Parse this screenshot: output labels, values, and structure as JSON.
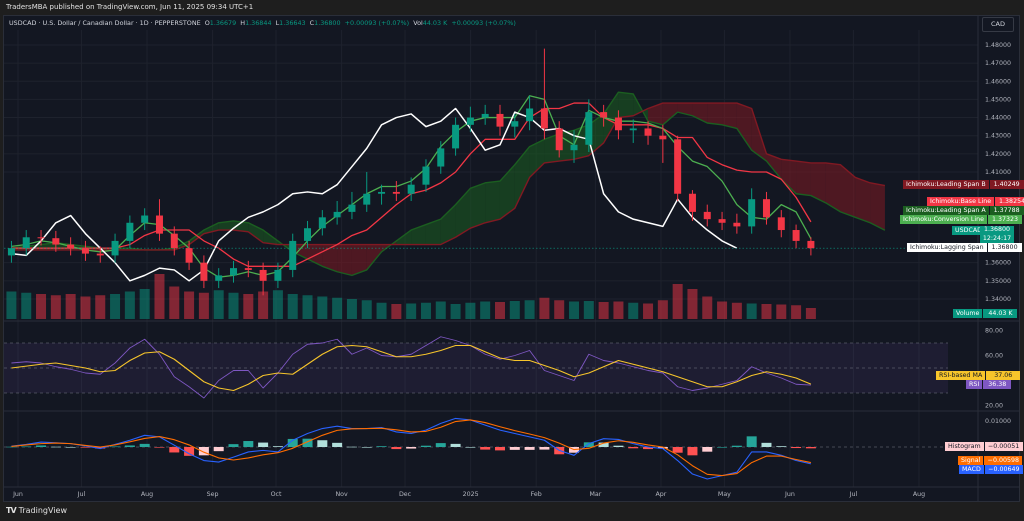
{
  "published": "TradersMBA published on TradingView.com, Jun 11, 2025 09:34 UTC+1",
  "legend": {
    "symbol": "USDCAD · U.S. Dollar / Canadian Dollar · 1D · PEPPERSTONE",
    "o_label": "O",
    "o": "1.36679",
    "h_label": "H",
    "h": "1.36844",
    "l_label": "L",
    "l": "1.36643",
    "c_label": "C",
    "c": "1.36800",
    "change": "+0.00093 (+0.07%)",
    "vol_label": "Vol",
    "vol": "44.03 K",
    "vol_change": "+0.00093 (+0.07%)"
  },
  "currency_button": "CAD",
  "footer": {
    "logo": "TV",
    "brand": "TradingView"
  },
  "labels": {
    "span_b": {
      "name": "Ichimoku:Leading Span B",
      "value": "1.40249",
      "color": "#801922"
    },
    "base": {
      "name": "Ichimoku:Base Line",
      "value": "1.38254",
      "color": "#f23645"
    },
    "span_a": {
      "name": "Ichimoku:Leading Span A",
      "value": "1.37788",
      "color": "#1b5e20"
    },
    "conversion": {
      "name": "Ichimoku:Conversion Line",
      "value": "1.37323",
      "color": "#4caf50"
    },
    "usdcad": {
      "name": "USDCAD",
      "value": "1.36800",
      "countdown": "12:24:17",
      "color": "#089981"
    },
    "lagging": {
      "name": "Ichimoku:Lagging Span",
      "value": "1.36800",
      "color": "#ffffff"
    },
    "volume": {
      "name": "Volume",
      "value": "44.03 K",
      "color": "#089981"
    },
    "rsi_ma": {
      "name": "RSI-based MA",
      "value": "37.06",
      "color": "#f7c52b"
    },
    "rsi": {
      "name": "RSI",
      "value": "36.38",
      "color": "#7e57c2"
    },
    "histogram": {
      "name": "Histogram",
      "value": "−0.00051",
      "color": "#ffcdd2"
    },
    "signal": {
      "name": "Signal",
      "value": "−0.00598",
      "color": "#ff6d00"
    },
    "macd": {
      "name": "MACD",
      "value": "−0.00649",
      "color": "#2962ff"
    }
  },
  "chart_data": {
    "type": "candlestick",
    "interval_shown": "weekly approximation of daily chart",
    "price_axis": {
      "ticks": [
        "1.48000",
        "1.47000",
        "1.46000",
        "1.45000",
        "1.44000",
        "1.43000",
        "1.42000",
        "1.41000",
        "1.36000",
        "1.35000",
        "1.34000"
      ],
      "range": [
        1.335,
        1.485
      ]
    },
    "time_axis": [
      {
        "label": "Jun",
        "date": "2024-06-01"
      },
      {
        "label": "Jul",
        "date": "2024-07-01"
      },
      {
        "label": "Aug",
        "date": "2024-08-01"
      },
      {
        "label": "Sep",
        "date": "2024-09-01"
      },
      {
        "label": "Oct",
        "date": "2024-10-01"
      },
      {
        "label": "Nov",
        "date": "2024-11-01"
      },
      {
        "label": "Dec",
        "date": "2024-12-01"
      },
      {
        "label": "2025",
        "date": "2025-01-01"
      },
      {
        "label": "Feb",
        "date": "2025-02-01"
      },
      {
        "label": "Mar",
        "date": "2025-03-01"
      },
      {
        "label": "Apr",
        "date": "2025-04-01"
      },
      {
        "label": "May",
        "date": "2025-05-01"
      },
      {
        "label": "Jun",
        "date": "2025-06-01"
      },
      {
        "label": "Jul",
        "date": "2025-07-01"
      },
      {
        "label": "Aug",
        "date": "2025-08-01"
      }
    ],
    "dates": [
      "2024-05-27",
      "2024-06-03",
      "2024-06-10",
      "2024-06-17",
      "2024-06-24",
      "2024-07-01",
      "2024-07-08",
      "2024-07-15",
      "2024-07-22",
      "2024-07-29",
      "2024-08-05",
      "2024-08-12",
      "2024-08-19",
      "2024-08-26",
      "2024-09-02",
      "2024-09-09",
      "2024-09-16",
      "2024-09-23",
      "2024-09-30",
      "2024-10-07",
      "2024-10-14",
      "2024-10-21",
      "2024-10-28",
      "2024-11-04",
      "2024-11-11",
      "2024-11-18",
      "2024-11-25",
      "2024-12-02",
      "2024-12-09",
      "2024-12-16",
      "2024-12-23",
      "2024-12-30",
      "2025-01-06",
      "2025-01-13",
      "2025-01-20",
      "2025-01-27",
      "2025-02-03",
      "2025-02-10",
      "2025-02-17",
      "2025-02-24",
      "2025-03-03",
      "2025-03-10",
      "2025-03-17",
      "2025-03-24",
      "2025-03-31",
      "2025-04-07",
      "2025-04-14",
      "2025-04-21",
      "2025-04-28",
      "2025-05-05",
      "2025-05-12",
      "2025-05-19",
      "2025-05-26",
      "2025-06-02",
      "2025-06-09",
      "2025-06-16",
      "2025-06-23",
      "2025-06-30",
      "2025-07-07",
      "2025-07-14"
    ],
    "open": [
      1.364,
      1.368,
      1.374,
      1.3735,
      1.37,
      1.368,
      1.365,
      1.364,
      1.372,
      1.382,
      1.386,
      1.376,
      1.368,
      1.36,
      1.35,
      1.353,
      1.357,
      1.356,
      1.35,
      1.356,
      1.372,
      1.379,
      1.385,
      1.388,
      1.392,
      1.398,
      1.399,
      1.398,
      1.403,
      1.413,
      1.423,
      1.436,
      1.44,
      1.442,
      1.435,
      1.438,
      1.445,
      1.434,
      1.422,
      1.425,
      1.443,
      1.44,
      1.433,
      1.434,
      1.43,
      1.428,
      1.398,
      1.388,
      1.384,
      1.382,
      1.38,
      1.395,
      1.385,
      1.378,
      1.372
    ],
    "high": [
      1.372,
      1.378,
      1.378,
      1.3775,
      1.374,
      1.372,
      1.369,
      1.376,
      1.386,
      1.39,
      1.395,
      1.38,
      1.372,
      1.364,
      1.357,
      1.361,
      1.361,
      1.36,
      1.36,
      1.376,
      1.383,
      1.389,
      1.394,
      1.399,
      1.41,
      1.403,
      1.405,
      1.407,
      1.417,
      1.427,
      1.44,
      1.446,
      1.447,
      1.447,
      1.442,
      1.452,
      1.478,
      1.438,
      1.433,
      1.45,
      1.447,
      1.444,
      1.439,
      1.438,
      1.436,
      1.43,
      1.4,
      1.392,
      1.388,
      1.387,
      1.401,
      1.399,
      1.389,
      1.381,
      1.374
    ],
    "low": [
      1.36,
      1.364,
      1.3695,
      1.366,
      1.364,
      1.361,
      1.36,
      1.36,
      1.368,
      1.378,
      1.372,
      1.364,
      1.356,
      1.346,
      1.346,
      1.349,
      1.352,
      1.342,
      1.346,
      1.352,
      1.368,
      1.375,
      1.381,
      1.384,
      1.388,
      1.392,
      1.394,
      1.394,
      1.399,
      1.409,
      1.419,
      1.432,
      1.436,
      1.43,
      1.429,
      1.433,
      1.428,
      1.418,
      1.415,
      1.421,
      1.435,
      1.428,
      1.426,
      1.425,
      1.415,
      1.394,
      1.383,
      1.38,
      1.378,
      1.376,
      1.376,
      1.381,
      1.374,
      1.368,
      1.364
    ],
    "close": [
      1.368,
      1.374,
      1.3735,
      1.37,
      1.368,
      1.365,
      1.364,
      1.372,
      1.382,
      1.386,
      1.376,
      1.368,
      1.36,
      1.35,
      1.353,
      1.357,
      1.356,
      1.35,
      1.356,
      1.372,
      1.379,
      1.385,
      1.388,
      1.392,
      1.398,
      1.399,
      1.398,
      1.403,
      1.413,
      1.423,
      1.436,
      1.44,
      1.442,
      1.435,
      1.438,
      1.445,
      1.434,
      1.422,
      1.425,
      1.443,
      1.44,
      1.433,
      1.434,
      1.43,
      1.428,
      1.398,
      1.388,
      1.384,
      1.382,
      1.38,
      1.395,
      1.385,
      1.378,
      1.372,
      1.368
    ],
    "volume_k": [
      110,
      105,
      100,
      95,
      100,
      90,
      95,
      100,
      110,
      120,
      180,
      130,
      110,
      105,
      115,
      105,
      100,
      110,
      115,
      100,
      95,
      90,
      85,
      80,
      75,
      65,
      60,
      62,
      65,
      70,
      60,
      65,
      70,
      68,
      72,
      75,
      85,
      75,
      70,
      72,
      68,
      70,
      65,
      62,
      75,
      140,
      120,
      90,
      70,
      65,
      62,
      60,
      58,
      55,
      44.03
    ],
    "colors": {
      "up": "#089981",
      "down": "#f23645",
      "conversion": "#4caf50",
      "base": "#f23645",
      "span_a": "#1b5e20",
      "span_b": "#801922",
      "lagging": "#ffffff",
      "cloud_up": "#1b5e20",
      "cloud_down": "#801922"
    },
    "ichimoku": {
      "displacement_days": 26,
      "conversion": [
        1.369,
        1.37,
        1.372,
        1.371,
        1.369,
        1.367,
        1.366,
        1.367,
        1.375,
        1.382,
        1.381,
        1.375,
        1.368,
        1.357,
        1.352,
        1.353,
        1.355,
        1.353,
        1.355,
        1.363,
        1.372,
        1.38,
        1.386,
        1.392,
        1.398,
        1.402,
        1.402,
        1.405,
        1.412,
        1.424,
        1.432,
        1.438,
        1.44,
        1.44,
        1.44,
        1.452,
        1.45,
        1.43,
        1.425,
        1.444,
        1.44,
        1.438,
        1.438,
        1.437,
        1.434,
        1.424,
        1.416,
        1.413,
        1.405,
        1.392,
        1.385,
        1.384,
        1.392,
        1.388,
        1.3732
      ],
      "base": [
        1.368,
        1.368,
        1.368,
        1.368,
        1.368,
        1.368,
        1.368,
        1.368,
        1.37,
        1.375,
        1.378,
        1.378,
        1.378,
        1.372,
        1.368,
        1.362,
        1.358,
        1.358,
        1.358,
        1.358,
        1.362,
        1.366,
        1.37,
        1.375,
        1.378,
        1.385,
        1.392,
        1.398,
        1.4,
        1.404,
        1.41,
        1.42,
        1.428,
        1.428,
        1.428,
        1.44,
        1.445,
        1.445,
        1.448,
        1.448,
        1.44,
        1.436,
        1.436,
        1.436,
        1.434,
        1.429,
        1.429,
        1.418,
        1.414,
        1.411,
        1.41,
        1.41,
        1.406,
        1.396,
        1.3825
      ],
      "span_a": [
        1.368,
        1.369,
        1.37,
        1.371,
        1.37,
        1.369,
        1.368,
        1.368,
        1.368,
        1.367,
        1.367,
        1.368,
        1.372,
        1.378,
        1.382,
        1.383,
        1.382,
        1.378,
        1.372,
        1.366,
        1.362,
        1.358,
        1.355,
        1.353,
        1.356,
        1.366,
        1.372,
        1.378,
        1.381,
        1.384,
        1.392,
        1.401,
        1.404,
        1.405,
        1.414,
        1.424,
        1.428,
        1.431,
        1.433,
        1.436,
        1.442,
        1.454,
        1.453,
        1.438,
        1.436,
        1.443,
        1.441,
        1.437,
        1.436,
        1.434,
        1.422,
        1.416,
        1.406,
        1.398,
        1.397,
        1.393,
        1.388,
        1.385,
        1.382,
        1.3779
      ],
      "span_b": [
        1.367,
        1.367,
        1.367,
        1.367,
        1.367,
        1.367,
        1.367,
        1.367,
        1.367,
        1.367,
        1.367,
        1.367,
        1.37,
        1.376,
        1.378,
        1.378,
        1.377,
        1.371,
        1.37,
        1.37,
        1.37,
        1.37,
        1.37,
        1.37,
        1.37,
        1.37,
        1.37,
        1.37,
        1.37,
        1.37,
        1.374,
        1.379,
        1.382,
        1.384,
        1.39,
        1.407,
        1.415,
        1.416,
        1.417,
        1.419,
        1.426,
        1.44,
        1.441,
        1.445,
        1.448,
        1.448,
        1.448,
        1.448,
        1.448,
        1.448,
        1.445,
        1.42,
        1.417,
        1.416,
        1.415,
        1.415,
        1.414,
        1.407,
        1.404,
        1.4025
      ]
    },
    "rsi": {
      "ticks": [
        "80.00",
        "60.00",
        "20.00"
      ],
      "range": [
        15,
        85
      ],
      "band": [
        30,
        70
      ],
      "rsi": [
        54,
        55,
        54,
        51,
        49,
        46,
        45,
        54,
        66,
        73,
        61,
        43,
        35,
        26,
        40,
        48,
        48,
        34,
        46,
        61,
        69,
        70,
        73,
        61,
        66,
        60,
        59,
        61,
        68,
        75,
        72,
        68,
        61,
        57,
        60,
        64,
        48,
        44,
        40,
        61,
        56,
        54,
        51,
        48,
        46,
        35,
        32,
        34,
        37,
        40,
        51,
        46,
        42,
        37,
        36.38
      ],
      "ma": [
        50,
        51.5,
        53,
        54,
        52,
        50,
        47,
        48,
        56,
        62,
        63,
        57,
        48,
        39,
        34,
        32,
        37,
        44,
        46,
        45,
        53,
        61,
        67,
        68,
        67,
        63,
        59,
        59,
        61,
        64,
        68,
        68,
        63,
        58,
        56,
        56,
        52,
        48,
        43,
        46,
        51,
        56,
        53,
        50,
        47,
        43,
        39,
        35,
        35,
        39,
        44,
        47,
        45,
        42,
        37.06
      ]
    },
    "macd": {
      "ticks": [
        "0.01000"
      ],
      "macd": [
        0.0003,
        0.001,
        0.0019,
        0.0016,
        0.0013,
        0.0004,
        -0.0006,
        0.001,
        0.0026,
        0.0045,
        0.0039,
        0.0007,
        -0.0026,
        -0.0052,
        -0.0058,
        -0.0039,
        -0.0019,
        -0.0013,
        -0.0019,
        0.0026,
        0.0052,
        0.0071,
        0.008,
        0.0071,
        0.0071,
        0.0075,
        0.0058,
        0.0052,
        0.0065,
        0.0091,
        0.011,
        0.0104,
        0.0084,
        0.0065,
        0.0052,
        0.0039,
        0.0026,
        -0.0013,
        -0.0032,
        0.0013,
        0.0032,
        0.0029,
        0.0013,
        0.0,
        -0.0006,
        -0.0052,
        -0.0104,
        -0.0123,
        -0.011,
        -0.0097,
        -0.0019,
        -0.0019,
        -0.0032,
        -0.0052,
        -0.00649
      ],
      "signal": [
        0.0002,
        0.0008,
        0.0013,
        0.0015,
        0.0013,
        0.0006,
        0.0,
        0.0008,
        0.002,
        0.0033,
        0.004,
        0.0028,
        0.0008,
        -0.002,
        -0.0042,
        -0.005,
        -0.0042,
        -0.003,
        -0.0022,
        -0.0005,
        0.002,
        0.0045,
        0.0064,
        0.007,
        0.0071,
        0.0072,
        0.0066,
        0.0058,
        0.006,
        0.0076,
        0.0098,
        0.0104,
        0.0094,
        0.0078,
        0.0063,
        0.005,
        0.0036,
        0.0015,
        -0.001,
        -0.0005,
        0.0015,
        0.0024,
        0.0018,
        0.0008,
        0.0,
        -0.003,
        -0.0072,
        -0.0105,
        -0.011,
        -0.0102,
        -0.006,
        -0.0035,
        -0.0035,
        -0.0048,
        -0.00598
      ]
    }
  }
}
